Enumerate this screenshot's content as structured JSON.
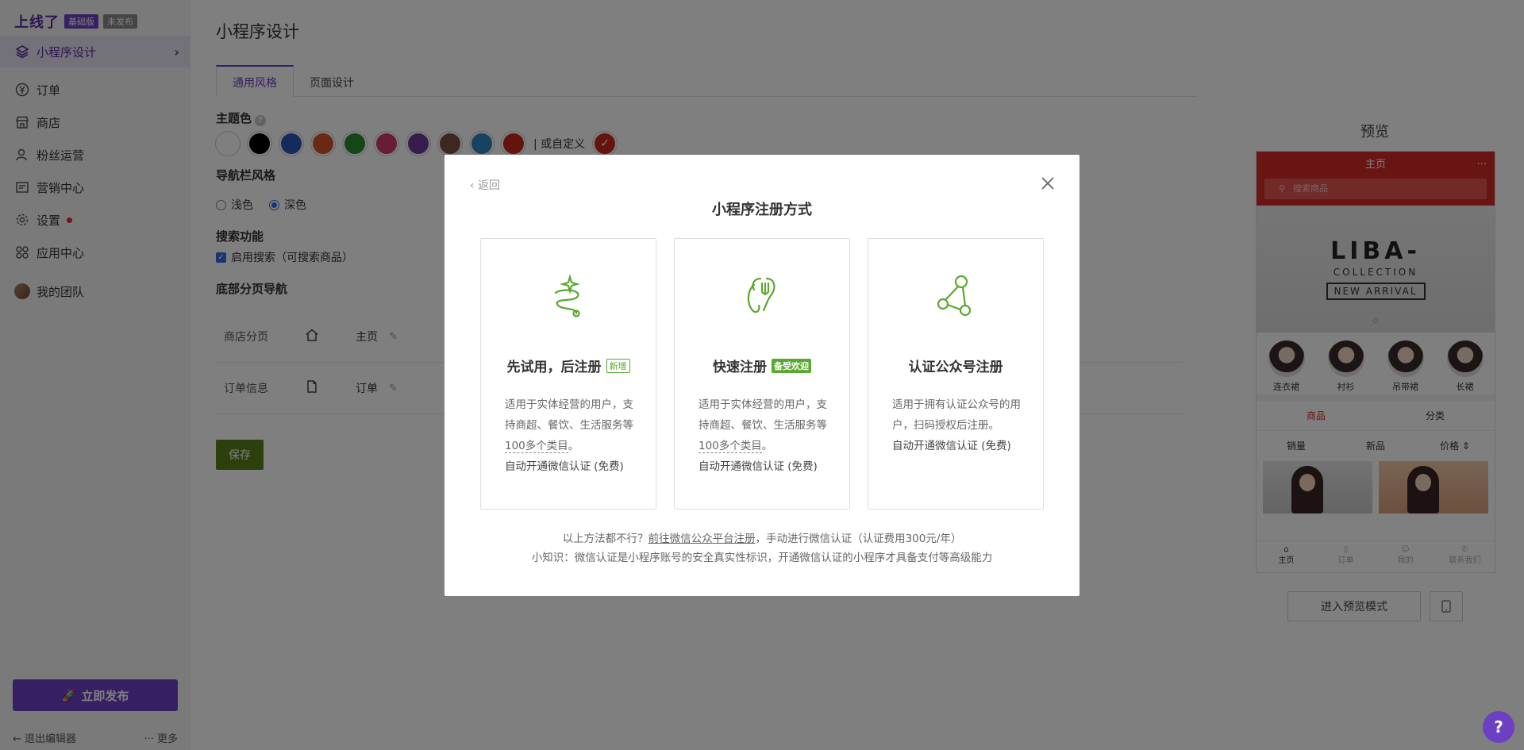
{
  "sidebar": {
    "brand": "上线了",
    "edition_badge": "基础版",
    "status_badge": "未发布",
    "items": [
      {
        "label": "小程序设计",
        "icon": "layers-icon"
      },
      {
        "label": "订单",
        "icon": "yen-circle-icon"
      },
      {
        "label": "商店",
        "icon": "store-icon"
      },
      {
        "label": "粉丝运营",
        "icon": "user-icon"
      },
      {
        "label": "营销中心",
        "icon": "campaign-icon"
      },
      {
        "label": "设置",
        "icon": "gear-icon"
      },
      {
        "label": "应用中心",
        "icon": "apps-grid-icon"
      },
      {
        "label": "我的团队",
        "icon": "team-avatar"
      }
    ],
    "publish_label": "立即发布",
    "exit_label": "退出编辑器",
    "more_label": "更多"
  },
  "main": {
    "page_title": "小程序设计",
    "tabs": [
      "通用风格",
      "页面设计"
    ],
    "theme_color_label": "主题色",
    "theme_colors": [
      "#ffffff",
      "#000000",
      "#2f54b8",
      "#d5522a",
      "#2f8a35",
      "#cc3a6a",
      "#6a3d9a",
      "#7a5040",
      "#2f85c0",
      "#c8261e"
    ],
    "custom_color_label": "| 或自定义",
    "custom_color": "#c8261e",
    "navbar_style_label": "导航栏风格",
    "navbar_options": [
      "浅色",
      "深色"
    ],
    "navbar_selected": "深色",
    "search_label": "搜索功能",
    "search_checkbox_label": "启用搜索（可搜索商品）",
    "bottom_nav_label": "底部分页导航",
    "bottom_nav_rows": [
      {
        "section": "商店分页",
        "icon": "home-icon",
        "name": "主页"
      },
      {
        "section": "订单信息",
        "icon": "document-icon",
        "name": "订单"
      }
    ],
    "save_label": "保存"
  },
  "preview": {
    "title": "预览",
    "phone_title": "主页",
    "phone_menu": "···",
    "search_placeholder": "搜索商品",
    "banner_line1": "LIBA-",
    "banner_line2": "COLLECTION",
    "banner_line3": "NEW ARRIVAL",
    "categories": [
      "连衣裙",
      "衬衫",
      "吊带裙",
      "长裙"
    ],
    "product_tabs": [
      "商品",
      "分类"
    ],
    "sorts": [
      "销量",
      "新品",
      "价格 ⇕"
    ],
    "bottom_nav": [
      "主页",
      "订单",
      "我的",
      "联系我们"
    ],
    "enter_preview_label": "进入预览模式"
  },
  "modal": {
    "back_label": "返回",
    "title": "小程序注册方式",
    "cards": [
      {
        "icon": "sparkle-path-icon",
        "title": "先试用，后注册",
        "tag": "新增",
        "desc_pre": "适用于实体经营的用户，支持商超、餐饮、生活服务等",
        "desc_link": "100多个类目",
        "desc_post": "。",
        "free": "自动开通微信认证 (免费)"
      },
      {
        "icon": "fork-spoon-icon",
        "title": "快速注册",
        "tag": "备受欢迎",
        "desc_pre": "适用于实体经营的用户，支持商超、餐饮、生活服务等",
        "desc_link": "100多个类目",
        "desc_post": "。",
        "free": "自动开通微信认证 (免费)"
      },
      {
        "icon": "share-nodes-icon",
        "title": "认证公众号注册",
        "desc": "适用于拥有认证公众号的用户，扫码授权后注册。",
        "free": "自动开通微信认证 (免费)"
      }
    ],
    "footer_pre": "以上方法都不行？",
    "footer_link": "前往微信公众平台注册",
    "footer_post": "，手动进行微信认证（认证费用300元/年）",
    "tip": "小知识：微信认证是小程序账号的安全真实性标识，开通微信认证的小程序才具备支付等高级能力"
  },
  "help_fab": "?"
}
